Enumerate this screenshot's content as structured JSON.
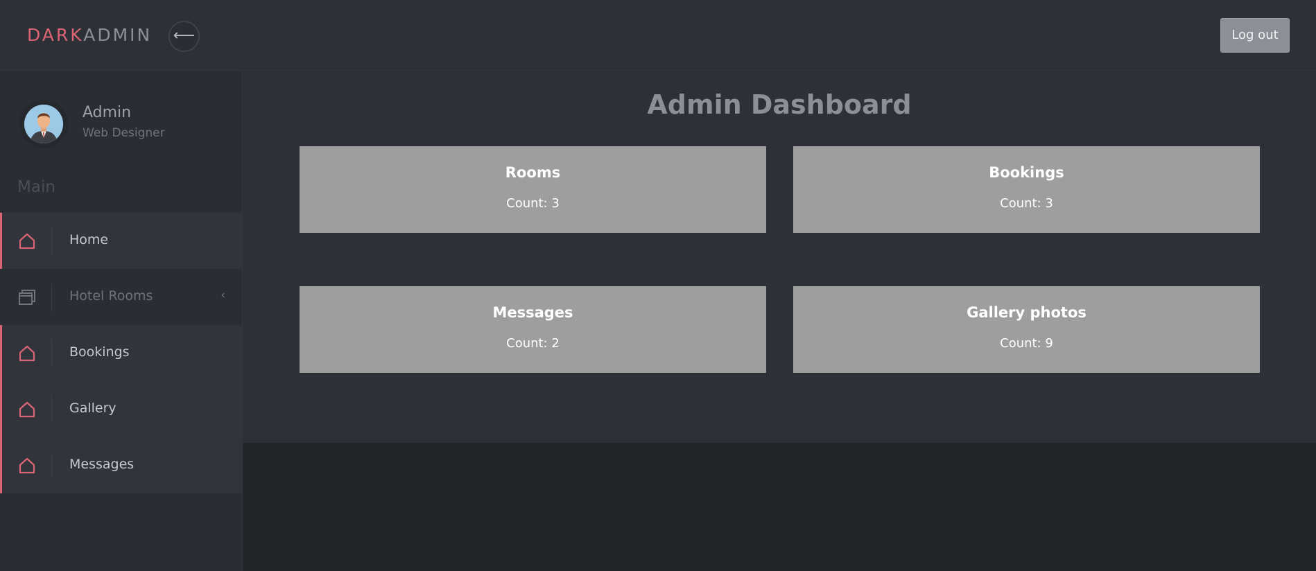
{
  "header": {
    "brand_part1": "DARK",
    "brand_part2": "ADMIN",
    "back_icon": "arrow-left-icon",
    "logout_label": "Log out"
  },
  "sidebar": {
    "profile": {
      "name": "Admin",
      "role": "Web Designer"
    },
    "section_title": "Main",
    "items": [
      {
        "label": "Home",
        "icon": "house-icon",
        "active": true
      },
      {
        "label": "Hotel Rooms",
        "icon": "window-icon",
        "active": false,
        "has_submenu": true,
        "chevron": "‹"
      },
      {
        "label": "Bookings",
        "icon": "house-icon",
        "active": true
      },
      {
        "label": "Gallery",
        "icon": "house-icon",
        "active": true
      },
      {
        "label": "Messages",
        "icon": "house-icon",
        "active": true
      }
    ]
  },
  "main": {
    "title": "Admin Dashboard",
    "cards": [
      {
        "title": "Rooms",
        "count": "Count: 3"
      },
      {
        "title": "Bookings",
        "count": "Count: 3"
      },
      {
        "title": "Messages",
        "count": "Count: 2"
      },
      {
        "title": "Gallery photos",
        "count": "Count: 9"
      }
    ]
  },
  "colors": {
    "accent": "#db6574",
    "card_bg": "#9e9e9e",
    "panel_bg": "#2d3036"
  }
}
